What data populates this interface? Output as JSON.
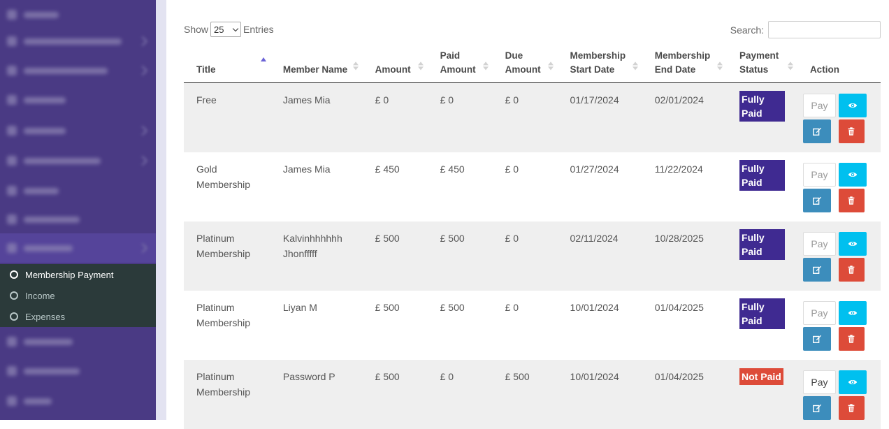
{
  "sidebar": {
    "submenu": [
      {
        "label": "Membership Payment",
        "active": true
      },
      {
        "label": "Income",
        "active": false
      },
      {
        "label": "Expenses",
        "active": false
      }
    ]
  },
  "table_controls": {
    "show_label": "Show",
    "entries_value": "25",
    "entries_label": "Entries",
    "search_label": "Search:",
    "search_value": ""
  },
  "columns": [
    {
      "line1": "Title",
      "line2": "",
      "sort": "asc"
    },
    {
      "line1": "Member Name",
      "line2": "",
      "sort": "both"
    },
    {
      "line1": "Amount",
      "line2": "",
      "sort": "both"
    },
    {
      "line1": "Paid",
      "line2": "Amount",
      "sort": "both"
    },
    {
      "line1": "Due",
      "line2": "Amount",
      "sort": "both"
    },
    {
      "line1": "Membership",
      "line2": "Start Date",
      "sort": "both"
    },
    {
      "line1": "Membership",
      "line2": "End Date",
      "sort": "both"
    },
    {
      "line1": "Payment",
      "line2": "Status",
      "sort": "both"
    },
    {
      "line1": "Action",
      "line2": "",
      "sort": "none"
    }
  ],
  "rows": [
    {
      "title1": "Free",
      "title2": "",
      "member1": "James Mia",
      "member2": "",
      "amount": "£ 0",
      "paid": "£ 0",
      "due": "£ 0",
      "start": "01/17/2024",
      "end": "02/01/2024",
      "status": "Fully Paid"
    },
    {
      "title1": "Gold",
      "title2": "Membership",
      "member1": "James Mia",
      "member2": "",
      "amount": "£ 450",
      "paid": "£ 450",
      "due": "£ 0",
      "start": "01/27/2024",
      "end": "11/22/2024",
      "status": "Fully Paid"
    },
    {
      "title1": "Platinum",
      "title2": "Membership",
      "member1": "Kalvinhhhhhh",
      "member2": "Jhonfffff",
      "amount": "£ 500",
      "paid": "£ 500",
      "due": "£ 0",
      "start": "02/11/2024",
      "end": "10/28/2025",
      "status": "Fully Paid"
    },
    {
      "title1": "Platinum",
      "title2": "Membership",
      "member1": "Liyan M",
      "member2": "",
      "amount": "£ 500",
      "paid": "£ 500",
      "due": "£ 0",
      "start": "10/01/2024",
      "end": "01/04/2025",
      "status": "Fully Paid"
    },
    {
      "title1": "Platinum",
      "title2": "Membership",
      "member1": "Password P",
      "member2": "",
      "amount": "£ 500",
      "paid": "£ 0",
      "due": "£ 500",
      "start": "10/01/2024",
      "end": "01/04/2025",
      "status": "Not Paid"
    }
  ],
  "action_labels": {
    "pay": "Pay"
  },
  "colors": {
    "sidebar": "#4a3a84",
    "submenu": "#2b3a3a",
    "fully_paid": "#3f2a91",
    "not_paid": "#dd4b39",
    "view_button": "#00c0ef",
    "edit_button": "#3c8dbc",
    "delete_button": "#dd4b39"
  }
}
